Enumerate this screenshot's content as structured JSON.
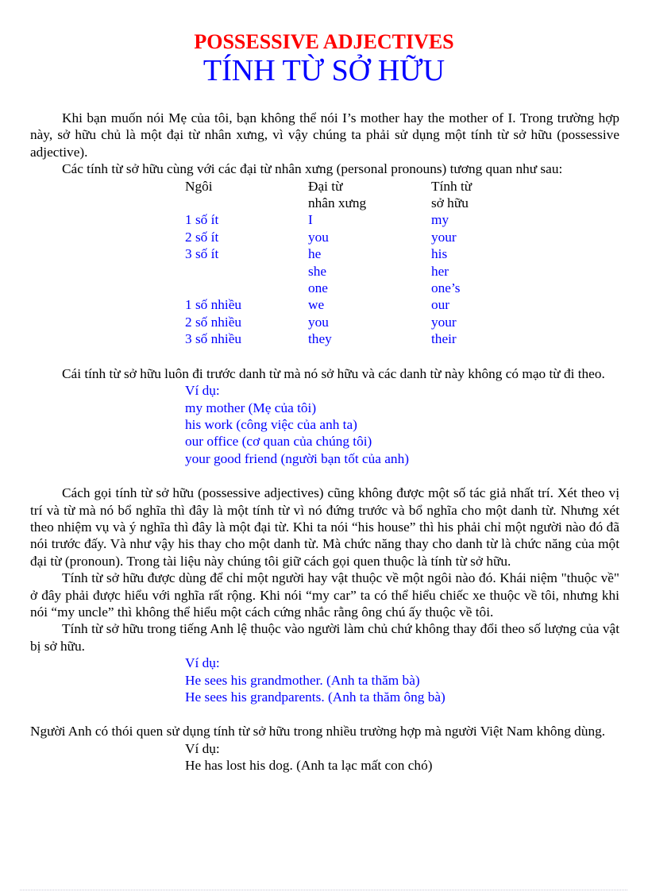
{
  "title": {
    "english": "POSSESSIVE ADJECTIVES",
    "vietnamese": "TÍNH TỪ SỞ HỮU"
  },
  "colors": {
    "title_english": "#ff0000",
    "title_vietnamese": "#0000ff",
    "highlight_text": "#0000ff",
    "body_text": "#000000"
  },
  "intro": {
    "paragraph1": "Khi bạn muốn nói Mẹ của tôi, bạn không thể nói I’s mother hay the mother of I. Trong trường hợp này, sở hữu chủ là một đại từ nhân xưng, vì vậy chúng ta phải sử dụng một tính từ sở hữu (possessive adjective).",
    "paragraph2": "Các tính từ sở hữu cùng với các đại từ nhân xưng (personal pronouns) tương quan như sau:"
  },
  "pronoun_table": {
    "headers": [
      {
        "line1": "Ngôi",
        "line2": ""
      },
      {
        "line1": "Đại từ",
        "line2": "nhân xưng"
      },
      {
        "line1": "Tính từ",
        "line2": "sở hữu"
      }
    ],
    "rows": [
      {
        "person": "1 số ít",
        "pronoun": "I",
        "adjective": "my"
      },
      {
        "person": "2 số ít",
        "pronoun": "you",
        "adjective": "your"
      },
      {
        "person": "3 số ít",
        "pronoun": "he",
        "adjective": "his"
      },
      {
        "person": "",
        "pronoun": "she",
        "adjective": "her"
      },
      {
        "person": "",
        "pronoun": "one",
        "adjective": "one’s"
      },
      {
        "person": "1 số nhiều",
        "pronoun": "we",
        "adjective": "our"
      },
      {
        "person": "2 số nhiều",
        "pronoun": "you",
        "adjective": "your"
      },
      {
        "person": "3 số nhiều",
        "pronoun": "they",
        "adjective": "their"
      }
    ]
  },
  "section2": {
    "paragraph": "Cái tính từ sở hữu luôn đi trước danh từ mà nó sở hữu và các danh từ này không có mạo từ đi theo.",
    "example_label": "Ví dụ:",
    "examples": [
      "my mother (Mẹ của tôi)",
      "his work (công việc của anh ta)",
      "our office (cơ quan của chúng tôi)",
      "your good friend (người bạn tốt của anh)"
    ]
  },
  "section3": {
    "paragraph1": "Cách gọi tính từ sở hữu (possessive adjectives) cũng không được một số tác giả nhất trí. Xét theo vị trí và từ mà nó bổ nghĩa thì đây là một tính từ vì nó đứng trước và bổ nghĩa cho một danh từ. Nhưng xét theo nhiệm vụ và ý nghĩa thì đây là một đại từ. Khi ta nói “his house” thì his phải chỉ một người nào đó đã nói trước đấy. Và như vậy his thay cho một danh từ. Mà chức năng thay cho danh từ là chức năng của một đại từ (pronoun). Trong tài liệu này chúng tôi giữ cách gọi quen thuộc là tính từ sở hữu.",
    "paragraph2": "Tính từ sở hữu được dùng để chỉ một người hay vật thuộc về một ngôi nào đó. Khái niệm \"thuộc về\" ở đây phải được hiểu với nghĩa rất rộng. Khi nói “my car” ta có thể hiểu chiếc xe thuộc về tôi, nhưng khi nói “my uncle” thì không thể hiểu một cách cứng nhắc rằng ông chú ấy thuộc về tôi.",
    "paragraph3": "Tính từ sở hữu trong tiếng Anh lệ thuộc vào người làm chủ chứ không thay đổi theo số lượng của vật bị sở hữu.",
    "example_label": "Ví dụ:",
    "examples": [
      "He sees his grandmother. (Anh ta thăm bà)",
      "He sees his grandparents. (Anh ta thăm ông bà)"
    ]
  },
  "section4": {
    "paragraph": "Người Anh có thói quen sử dụng tính từ sở hữu trong nhiều trường hợp mà người Việt Nam không dùng.",
    "example_label": "Ví dụ:",
    "examples": [
      "He has lost his dog. (Anh ta lạc mất con chó)"
    ]
  }
}
